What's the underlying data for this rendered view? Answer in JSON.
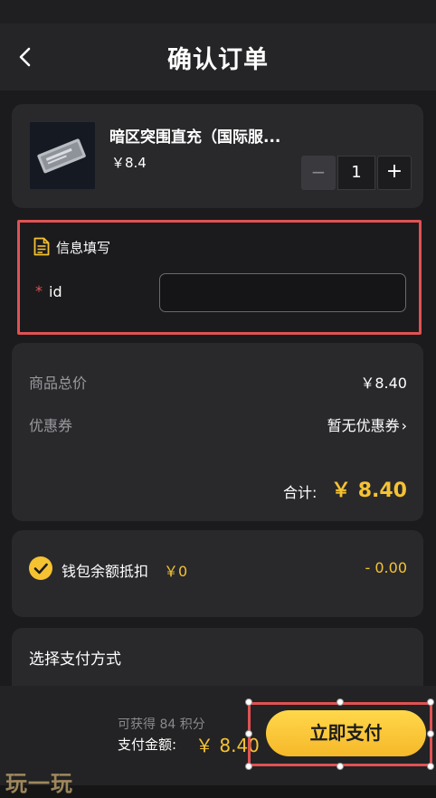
{
  "nav": {
    "title": "确认订单",
    "back_icon": "chevron-left-icon"
  },
  "product": {
    "name": "暗区突围直充（国际服...",
    "price": "￥8.4",
    "quantity": "1",
    "minus_label": "−",
    "plus_label": "+"
  },
  "info": {
    "title": "信息填写",
    "required_mark": "*",
    "id_label": "id",
    "id_value": ""
  },
  "summary": {
    "goods_total_label": "商品总价",
    "goods_total_value": "￥8.40",
    "coupon_label": "优惠券",
    "coupon_value": "暂无优惠券",
    "coupon_chevron": "›",
    "total_label": "合计:",
    "total_value": "￥ 8.40"
  },
  "wallet": {
    "label": "钱包余额抵扣",
    "balance": "￥0",
    "deduction": "- 0.00",
    "checked": true
  },
  "payment": {
    "title": "选择支付方式"
  },
  "bottom": {
    "points_text": "可获得 84 积分",
    "pay_amount_label": "支付金额:",
    "pay_amount_value": "￥ 8.40",
    "pay_button": "立即支付"
  },
  "watermark": "玩一玩",
  "colors": {
    "accent": "#f5c232",
    "highlight_border": "#e05253",
    "card_bg": "#29292c",
    "page_bg": "#1b1b1d"
  }
}
